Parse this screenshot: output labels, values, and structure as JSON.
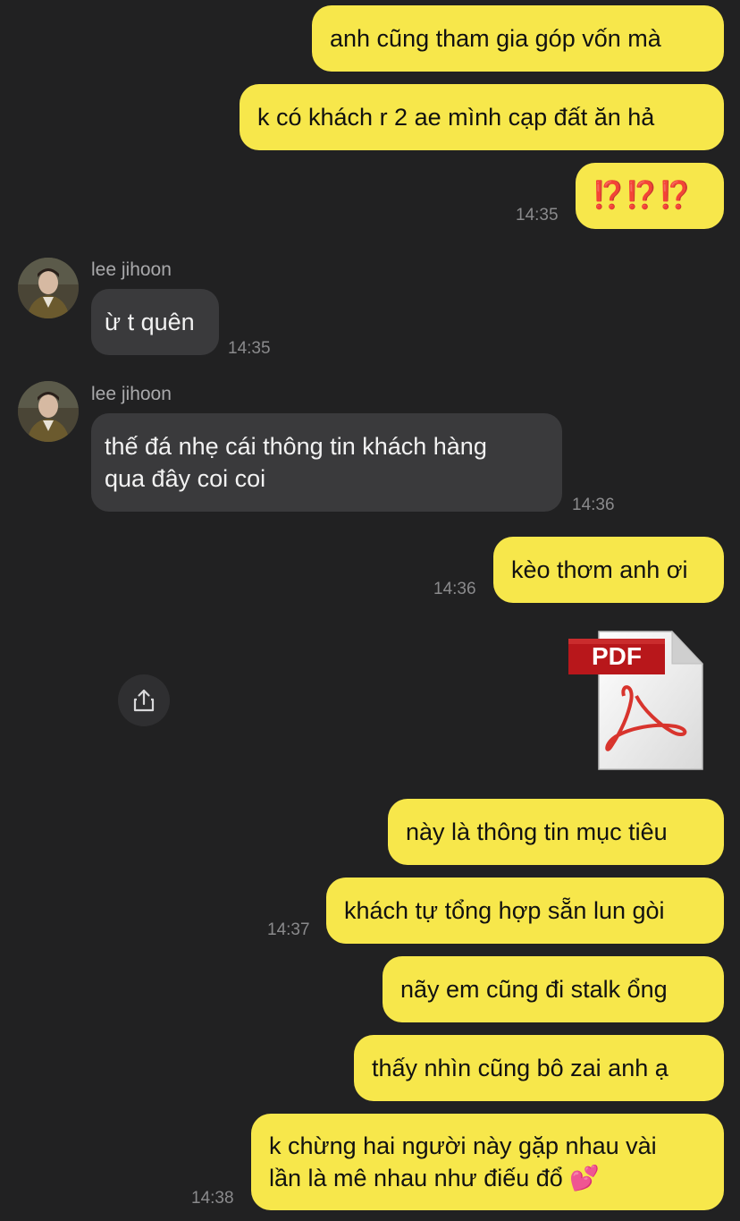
{
  "messages": {
    "m1": "anh cũng tham gia góp vốn mà",
    "m2": "k có khách r 2 ae mình cạp đất ăn hả",
    "m3": "⁉️⁉️⁉️",
    "m3_time": "14:35",
    "r1_name": "lee jihoon",
    "r1": "ừ t quên",
    "r1_time": "14:35",
    "r2_name": "lee jihoon",
    "r2_line1": "thế đá nhẹ cái thông tin khách hàng",
    "r2_line2": "qua đây coi coi",
    "r2_time": "14:36",
    "m4": "kèo thơm anh ơi",
    "m4_time": "14:36",
    "file_label": "PDF",
    "m5": "này là thông tin mục tiêu",
    "m6": "khách tự tổng hợp sẵn lun gòi",
    "m6_time": "14:37",
    "m7": "nãy em cũng đi stalk ổng",
    "m8": "thấy nhìn cũng bô zai anh ạ",
    "m9_line1": "k chừng hai người này gặp nhau vài",
    "m9_line2": "lần là mê nhau như điếu đổ 💕",
    "m9_time": "14:38"
  },
  "colors": {
    "background": "#212122",
    "my_bubble": "#f7e74b",
    "their_bubble": "#3a3a3c",
    "pdf_red": "#b91c1c"
  },
  "icons": {
    "share": "share-icon",
    "file": "pdf-file-icon"
  }
}
